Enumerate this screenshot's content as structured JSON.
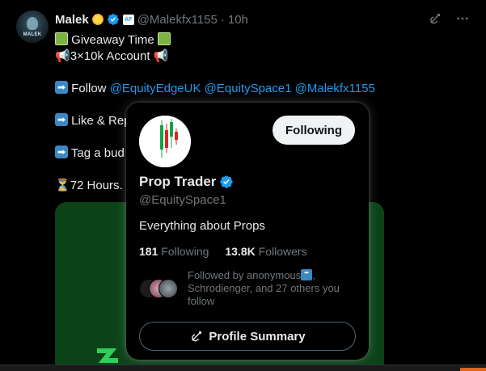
{
  "tweet": {
    "author_name": "Malek",
    "handle": "@Malekfx1155",
    "time": "10h",
    "avatar_text": "MALEK",
    "lines": {
      "l1": "Giveaway Time",
      "l2": "3×10k Account",
      "follow_label": "Follow",
      "mention1": "@EquityEdgeUK",
      "mention2": "@EquitySpace1",
      "mention3": "@Malekfx1155",
      "like_label": "Like & Rep",
      "tag_label": "Tag a bud",
      "hours_label": "72 Hours."
    }
  },
  "hovercard": {
    "name": "Prop Trader",
    "handle": "@EquitySpace1",
    "bio": "Everything about Props",
    "following_count": "181",
    "following_label": "Following",
    "followers_count": "13.8K",
    "followers_label": "Followers",
    "follow_button": "Following",
    "followed_by": "Followed by anonymous",
    "followed_by_rest": ", Schrodienger, and 27 others you follow",
    "summary_button": "Profile Summary"
  },
  "icons": {
    "verified": "verified-badge-icon",
    "affiliate": "affiliate-badge-icon",
    "grok": "grok-icon",
    "more": "more-icon",
    "money": "money-emoji-icon",
    "megaphone": "megaphone-emoji-icon",
    "arrow": "arrow-emoji-icon",
    "hourglass": "hourglass-emoji-icon"
  },
  "colors": {
    "accent": "#1d9bf0",
    "background": "#000000",
    "media_green": "#0b4218"
  }
}
